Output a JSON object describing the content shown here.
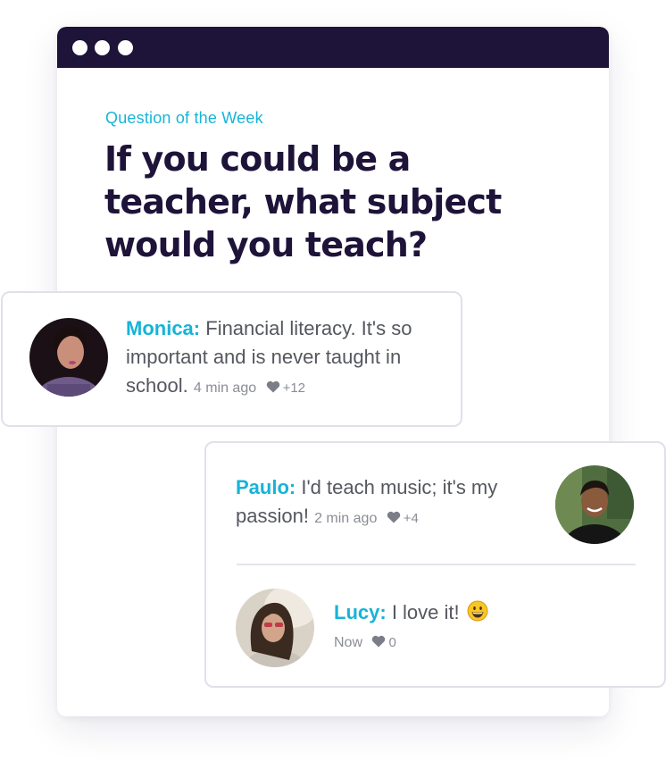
{
  "question_card": {
    "eyebrow": "Question of the Week",
    "headline": "If you could be a teacher, what subject would you teach?"
  },
  "comments": [
    {
      "name": "Monica:",
      "text": "Financial literacy. It's so important and is never taught in school.",
      "time": "4 min ago",
      "likes": "+12",
      "avatar": "monica-avatar"
    },
    {
      "name": "Paulo:",
      "text": "I'd teach music; it's my passion!",
      "time": "2 min ago",
      "likes": "+4",
      "avatar": "paulo-avatar"
    },
    {
      "name": "Lucy:",
      "text": "I love it!",
      "emoji": "grinning-face-emoji",
      "time": "Now",
      "likes": "0",
      "avatar": "lucy-avatar"
    }
  ],
  "colors": {
    "brand_dark": "#1e1339",
    "accent_cyan": "#16b4d8",
    "body_text": "#55575f",
    "meta_text": "#8a8d96",
    "card_border": "#dfe1ea"
  }
}
